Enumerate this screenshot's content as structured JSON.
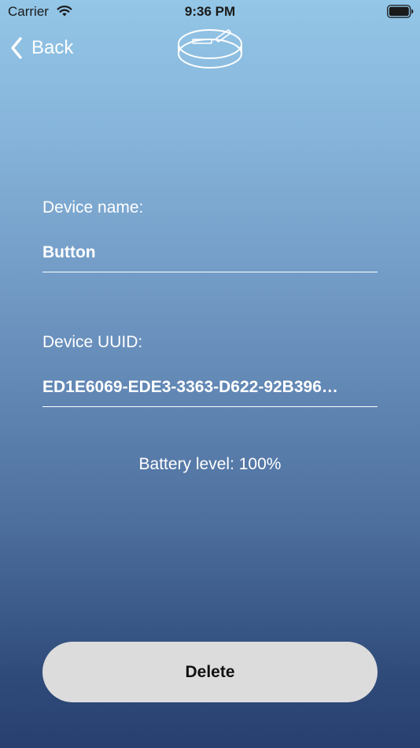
{
  "status_bar": {
    "carrier": "Carrier",
    "time": "9:36 PM",
    "wifi_icon": "wifi-icon",
    "battery_icon": "battery-icon"
  },
  "nav": {
    "back_label": "Back",
    "back_icon": "chevron-left-icon",
    "logo_icon": "device-logo-icon"
  },
  "form": {
    "name_label": "Device name:",
    "name_value": "Button",
    "uuid_label": "Device UUID:",
    "uuid_value": "ED1E6069-EDE3-3363-D622-92B396…"
  },
  "battery_text": "Battery level: 100%",
  "delete_label": "Delete",
  "colors": {
    "gradient_top": "#93c6e7",
    "gradient_bottom": "#283f6e",
    "button_bg": "#dcdcdc",
    "text": "#ffffff"
  }
}
